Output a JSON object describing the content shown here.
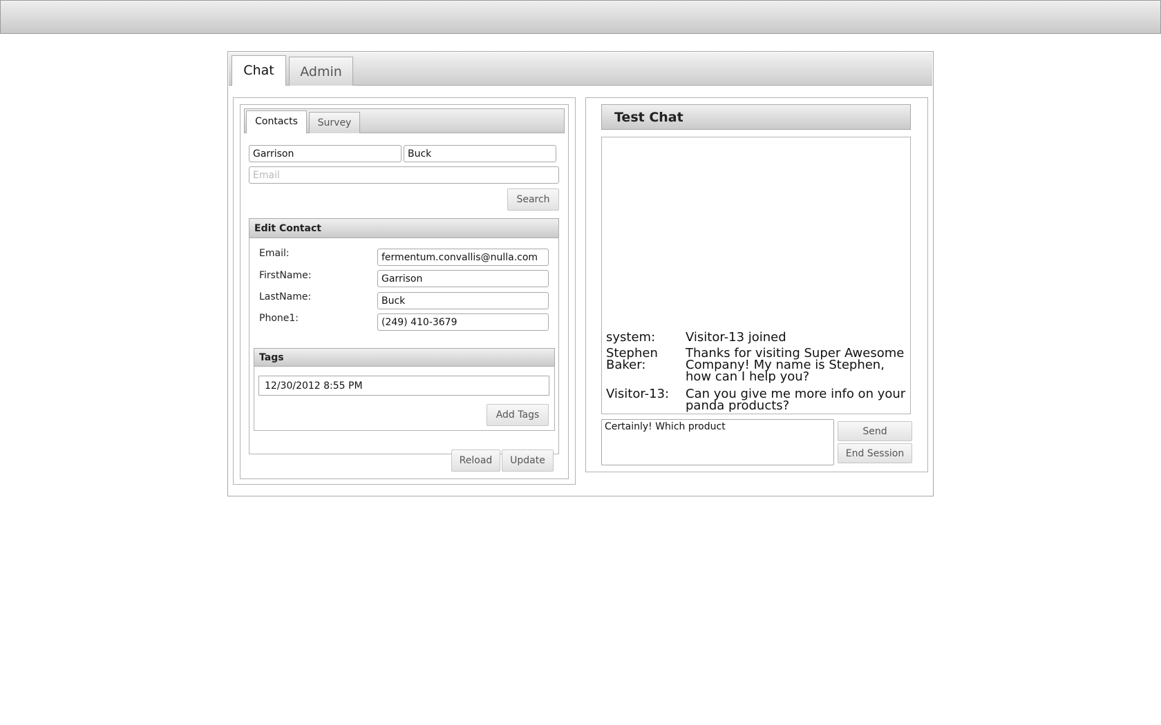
{
  "main_tabs": [
    {
      "label": "Chat",
      "active": true
    },
    {
      "label": "Admin",
      "active": false
    }
  ],
  "contacts_panel": {
    "tabs": [
      {
        "label": "Contacts",
        "active": true
      },
      {
        "label": "Survey",
        "active": false
      }
    ],
    "search": {
      "first_name_value": "Garrison",
      "last_name_value": "Buck",
      "email_value": "",
      "email_placeholder": "Email",
      "search_label": "Search"
    },
    "edit_contact": {
      "title": "Edit Contact",
      "fields": [
        {
          "label": "Email:",
          "value": "fermentum.convallis@nulla.com"
        },
        {
          "label": "FirstName:",
          "value": "Garrison"
        },
        {
          "label": "LastName:",
          "value": "Buck"
        },
        {
          "label": "Phone1:",
          "value": "(249) 410-3679"
        }
      ],
      "tags": {
        "title": "Tags",
        "value": "12/30/2012 8:55 PM",
        "add_label": "Add Tags"
      },
      "reload_label": "Reload",
      "update_label": "Update"
    }
  },
  "chat_panel": {
    "title": "Test Chat",
    "messages": [
      {
        "sender": "system:",
        "text": "Visitor-13 joined"
      },
      {
        "sender": "Stephen Baker:",
        "text": "Thanks for visiting Super Awesome Company! My name is Stephen, how can I help you?"
      },
      {
        "sender": "Visitor-13:",
        "text": "Can you give me more info on your panda products?"
      }
    ],
    "input_value": "Certainly! Which product",
    "send_label": "Send",
    "end_session_label": "End Session"
  }
}
